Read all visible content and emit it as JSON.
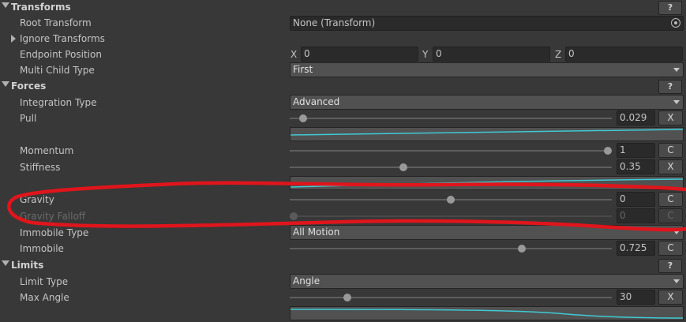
{
  "transforms": {
    "title": "Transforms",
    "help": "?",
    "root_transform": {
      "label": "Root Transform",
      "value": "None (Transform)"
    },
    "ignore_transforms": {
      "label": "Ignore Transforms"
    },
    "endpoint_position": {
      "label": "Endpoint Position",
      "x_label": "X",
      "x": "0",
      "y_label": "Y",
      "y": "0",
      "z_label": "Z",
      "z": "0"
    },
    "multi_child_type": {
      "label": "Multi Child Type",
      "value": "First"
    }
  },
  "forces": {
    "title": "Forces",
    "help": "?",
    "integration_type": {
      "label": "Integration Type",
      "value": "Advanced"
    },
    "pull": {
      "label": "Pull",
      "value": "0.029",
      "button": "X",
      "slider_fraction": 0.029
    },
    "momentum": {
      "label": "Momentum",
      "value": "1",
      "button": "C",
      "slider_fraction": 1.0
    },
    "stiffness": {
      "label": "Stiffness",
      "value": "0.35",
      "button": "X",
      "slider_fraction": 0.35
    },
    "gravity": {
      "label": "Gravity",
      "value": "0",
      "button": "C",
      "slider_fraction": 0.5
    },
    "gravity_falloff": {
      "label": "Gravity Falloff",
      "value": "0",
      "button": "C",
      "slider_fraction": 0.0
    },
    "immobile_type": {
      "label": "Immobile Type",
      "value": "All Motion"
    },
    "immobile": {
      "label": "Immobile",
      "value": "0.725",
      "button": "C",
      "slider_fraction": 0.725
    }
  },
  "limits": {
    "title": "Limits",
    "help": "?",
    "limit_type": {
      "label": "Limit Type",
      "value": "Angle"
    },
    "max_angle": {
      "label": "Max Angle",
      "value": "30",
      "button": "X",
      "slider_fraction": 0.17
    }
  },
  "colors": {
    "background": "#383838",
    "curve_line": "#3fc9d4",
    "annotation": "#e0151c"
  }
}
